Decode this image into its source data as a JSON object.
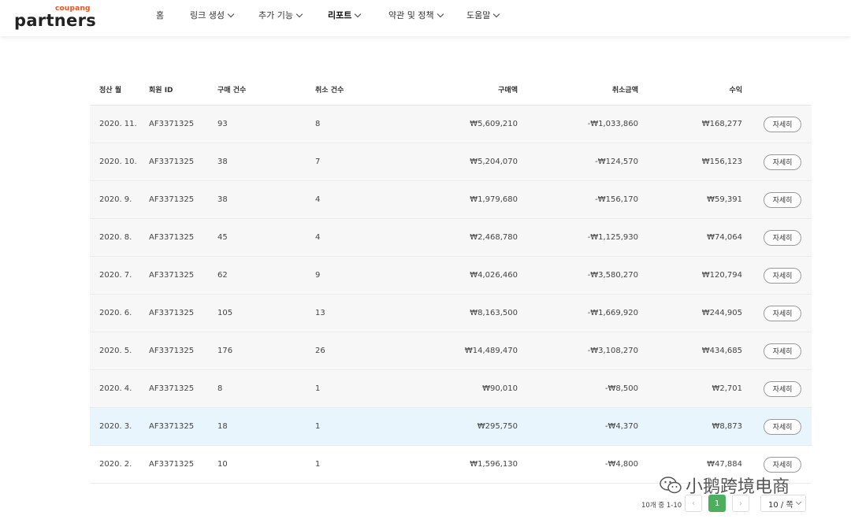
{
  "logo": {
    "small": "coupang",
    "big": "partners"
  },
  "nav": [
    {
      "label": "홈",
      "chevron": false,
      "active": false
    },
    {
      "label": "링크 생성",
      "chevron": true,
      "active": false
    },
    {
      "label": "추가 기능",
      "chevron": true,
      "active": false
    },
    {
      "label": "리포트",
      "chevron": true,
      "active": true
    },
    {
      "label": "약관 및 정책",
      "chevron": true,
      "active": false
    },
    {
      "label": "도움말",
      "chevron": true,
      "active": false
    }
  ],
  "table": {
    "headers": {
      "month": "정산 월",
      "member_id": "회원 ID",
      "purchases": "구매 건수",
      "cancellations": "취소 건수",
      "purchase_amount": "구매액",
      "cancel_amount": "취소금액",
      "revenue": "수익"
    },
    "detail_label": "자세히",
    "rows": [
      {
        "month": "2020. 11.",
        "id": "AF3371325",
        "purchases": "93",
        "cancels": "8",
        "amount": "₩5,609,210",
        "cancel_amount": "-₩1,033,860",
        "revenue": "₩168,277"
      },
      {
        "month": "2020. 10.",
        "id": "AF3371325",
        "purchases": "38",
        "cancels": "7",
        "amount": "₩5,204,070",
        "cancel_amount": "-₩124,570",
        "revenue": "₩156,123"
      },
      {
        "month": "2020. 9.",
        "id": "AF3371325",
        "purchases": "38",
        "cancels": "4",
        "amount": "₩1,979,680",
        "cancel_amount": "-₩156,170",
        "revenue": "₩59,391"
      },
      {
        "month": "2020. 8.",
        "id": "AF3371325",
        "purchases": "45",
        "cancels": "4",
        "amount": "₩2,468,780",
        "cancel_amount": "-₩1,125,930",
        "revenue": "₩74,064"
      },
      {
        "month": "2020. 7.",
        "id": "AF3371325",
        "purchases": "62",
        "cancels": "9",
        "amount": "₩4,026,460",
        "cancel_amount": "-₩3,580,270",
        "revenue": "₩120,794"
      },
      {
        "month": "2020. 6.",
        "id": "AF3371325",
        "purchases": "105",
        "cancels": "13",
        "amount": "₩8,163,500",
        "cancel_amount": "-₩1,669,920",
        "revenue": "₩244,905"
      },
      {
        "month": "2020. 5.",
        "id": "AF3371325",
        "purchases": "176",
        "cancels": "26",
        "amount": "₩14,489,470",
        "cancel_amount": "-₩3,108,270",
        "revenue": "₩434,685"
      },
      {
        "month": "2020. 4.",
        "id": "AF3371325",
        "purchases": "8",
        "cancels": "1",
        "amount": "₩90,010",
        "cancel_amount": "-₩8,500",
        "revenue": "₩2,701"
      },
      {
        "month": "2020. 3.",
        "id": "AF3371325",
        "purchases": "18",
        "cancels": "1",
        "amount": "₩295,750",
        "cancel_amount": "-₩4,370",
        "revenue": "₩8,873"
      },
      {
        "month": "2020. 2.",
        "id": "AF3371325",
        "purchases": "10",
        "cancels": "1",
        "amount": "₩1,596,130",
        "cancel_amount": "-₩4,800",
        "revenue": "₩47,884"
      }
    ]
  },
  "pagination": {
    "info": "10개 중 1-10",
    "prev": "‹",
    "current_page": "1",
    "next": "›",
    "page_size": "10 / 쪽"
  },
  "watermark": {
    "text": "小鹅跨境电商"
  },
  "colors": {
    "accent_green": "#4cae5e",
    "logo_orange": "#e8541c",
    "highlight_row": "#e8f5fd"
  }
}
